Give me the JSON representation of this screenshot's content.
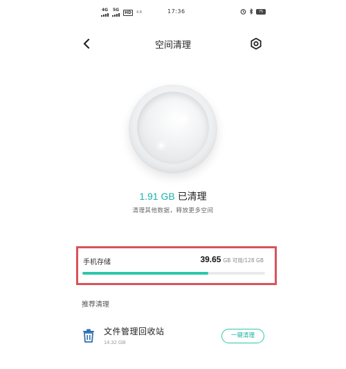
{
  "status_bar": {
    "net1": "4G",
    "net2": "5G",
    "hd": "HD",
    "wifi": "4.8",
    "time": "17:36",
    "battery": "75"
  },
  "header": {
    "title": "空间清理",
    "back_icon": "chevron-left-icon",
    "settings_icon": "gear-icon"
  },
  "result": {
    "cleaned_size": "1.91 GB",
    "cleaned_label": "已清理",
    "hint": "清理其他数据，释放更多空间"
  },
  "storage": {
    "label": "手机存储",
    "available": "39.65",
    "available_unit": "GB 可用/128 GB",
    "used_fraction": 0.69
  },
  "recommended": {
    "section_title": "推荐清理",
    "items": [
      {
        "name": "文件管理回收站",
        "size": "14.32 GB",
        "button_label": "一键清理",
        "icon": "trash-icon"
      }
    ]
  },
  "colors": {
    "accent": "#2ec6a8",
    "accent_text": "#19b3a3",
    "highlight_border": "#d9525a"
  }
}
